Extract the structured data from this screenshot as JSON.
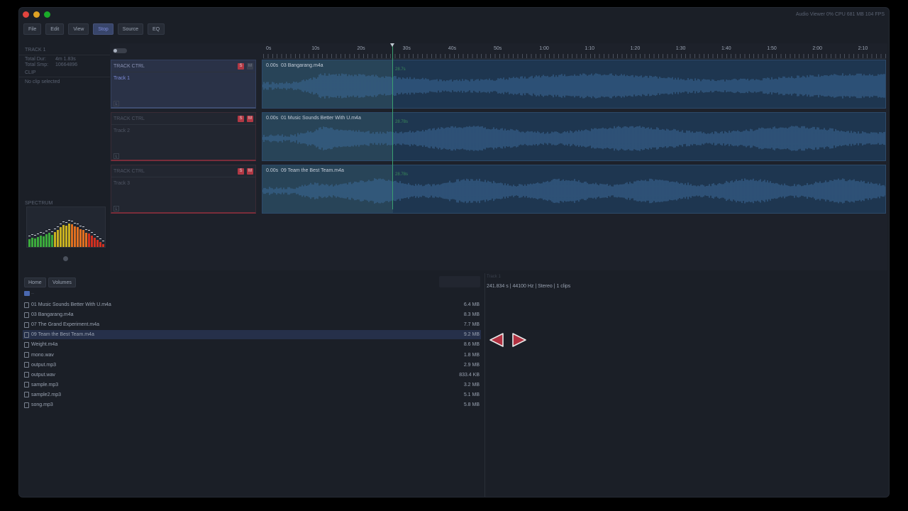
{
  "window": {
    "status": "Audio Viewer  0% CPU  681 MB  104 FPS"
  },
  "toolbar": {
    "buttons": [
      {
        "label": "File",
        "active": false
      },
      {
        "label": "Edit",
        "active": false
      },
      {
        "label": "View",
        "active": false
      },
      {
        "label": "Stop",
        "active": true
      },
      {
        "label": "Source",
        "active": false
      },
      {
        "label": "EQ",
        "active": false
      }
    ]
  },
  "left_panel": {
    "track_heading": "TRACK 1",
    "total_dur_label": "Total Dur:",
    "total_dur_value": "4m 1.83s",
    "total_smp_label": "Total Smp:",
    "total_smp_value": "10664896",
    "clip_heading": "CLIP",
    "clip_status": "No clip selected",
    "spectrum_label": "SPECTRUM",
    "spectrum_levels": [
      0.22,
      0.26,
      0.24,
      0.28,
      0.32,
      0.3,
      0.36,
      0.4,
      0.34,
      0.42,
      0.48,
      0.56,
      0.62,
      0.6,
      0.66,
      0.64,
      0.58,
      0.56,
      0.5,
      0.48,
      0.4,
      0.38,
      0.32,
      0.26,
      0.2,
      0.14,
      0.08
    ],
    "spectrum_colors": [
      "#3caa3c",
      "#c8b020",
      "#e07020",
      "#d03020"
    ]
  },
  "timeline": {
    "ruler_labels": [
      "0s",
      "10s",
      "20s",
      "30s",
      "40s",
      "50s",
      "1:00",
      "1:10",
      "1:20",
      "1:30",
      "1:40",
      "1:50",
      "2:00",
      "2:10"
    ],
    "playhead_time": "28.7s",
    "tracks": [
      {
        "ctrl_title": "TRACK CTRL",
        "name": "Track 1",
        "solo": "S",
        "mute": "M",
        "lock": "L",
        "clip_start": "0.00s",
        "clip_name": "03 Bangarang.m4a",
        "pos_label": "28.7s",
        "selected": true
      },
      {
        "ctrl_title": "TRACK CTRL",
        "name": "Track 2",
        "solo": "S",
        "mute": "M",
        "lock": "L",
        "clip_start": "0.00s",
        "clip_name": "01 Music Sounds Better With U.m4a",
        "pos_label": "28.78s",
        "selected": false
      },
      {
        "ctrl_title": "TRACK CTRL",
        "name": "Track 3",
        "solo": "S",
        "mute": "M",
        "lock": "L",
        "clip_start": "0.00s",
        "clip_name": "09 Team the Best Team.m4a",
        "pos_label": "28.78s",
        "selected": false
      }
    ]
  },
  "browser": {
    "locations": [
      "Home",
      "Volumes"
    ],
    "parent_label": "..",
    "files": [
      {
        "name": "01 Music Sounds Better With U.m4a",
        "size": "6.4 MB",
        "selected": false
      },
      {
        "name": "03 Bangarang.m4a",
        "size": "8.3 MB",
        "selected": false
      },
      {
        "name": "07 The Grand Experiment.m4a",
        "size": "7.7 MB",
        "selected": false
      },
      {
        "name": "09 Team the Best Team.m4a",
        "size": "9.2 MB",
        "selected": true
      },
      {
        "name": "Weight.m4a",
        "size": "8.6 MB",
        "selected": false
      },
      {
        "name": "mono.wav",
        "size": "1.8 MB",
        "selected": false
      },
      {
        "name": "output.mp3",
        "size": "2.9 MB",
        "selected": false
      },
      {
        "name": "output.wav",
        "size": "833.4 KB",
        "selected": false
      },
      {
        "name": "sample.mp3",
        "size": "3.2 MB",
        "selected": false
      },
      {
        "name": "sample2.mp3",
        "size": "5.1 MB",
        "selected": false
      },
      {
        "name": "song.mp3",
        "size": "5.8 MB",
        "selected": false
      }
    ]
  },
  "info_panel": {
    "title": "Track 1",
    "meta": "241.834 s  |  44100 Hz  |  Stereo  |  1 clips"
  }
}
